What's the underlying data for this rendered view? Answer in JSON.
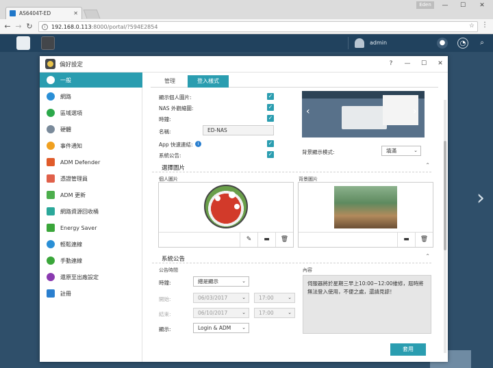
{
  "browser": {
    "tab_title": "AS6404T-ED",
    "user_chip": "Eden",
    "url_host": "192.168.0.113",
    "url_path": ":8000/portal/?594E2854"
  },
  "taskbar": {
    "user": "admin"
  },
  "dialog": {
    "title": "偏好設定",
    "controls": {
      "help": "?",
      "minimize": "—",
      "maximize": "☐",
      "close": "✕"
    }
  },
  "sidebar": {
    "items": [
      {
        "label": "一般",
        "icon": "general-icon",
        "color": "#ffffff"
      },
      {
        "label": "網路",
        "icon": "network-icon",
        "color": "#2a8fd6"
      },
      {
        "label": "區域選項",
        "icon": "region-icon",
        "color": "#2ba84a"
      },
      {
        "label": "硬體",
        "icon": "hardware-icon",
        "color": "#7a8a9a"
      },
      {
        "label": "事件通知",
        "icon": "notification-icon",
        "color": "#f0a020"
      },
      {
        "label": "ADM Defender",
        "icon": "defender-icon",
        "color": "#e05b2a"
      },
      {
        "label": "憑證管理員",
        "icon": "certificate-icon",
        "color": "#e0604a"
      },
      {
        "label": "ADM 更新",
        "icon": "update-icon",
        "color": "#4cae4c"
      },
      {
        "label": "網路資源回收桶",
        "icon": "recycle-bin-icon",
        "color": "#2ba89a"
      },
      {
        "label": "Energy Saver",
        "icon": "energy-saver-icon",
        "color": "#3aa63a"
      },
      {
        "label": "輕鬆連線",
        "icon": "cloud-connect-icon",
        "color": "#2a8fd6"
      },
      {
        "label": "手動連線",
        "icon": "manual-connect-icon",
        "color": "#3aa63a"
      },
      {
        "label": "還原至出廠設定",
        "icon": "restore-icon",
        "color": "#8a3ab0"
      },
      {
        "label": "註冊",
        "icon": "register-icon",
        "color": "#2a7fcf"
      }
    ]
  },
  "tabs": [
    "管理",
    "登入樣式"
  ],
  "login_style": {
    "show_personal_image": "顯示個人圖片:",
    "nas_thumbnail": "NAS 外觀縮圖:",
    "clock": "時鐘:",
    "name_label": "名稱:",
    "name_value": "ED-NAS",
    "app_shortcut": "App 快速連結:",
    "announcement": "系統公告:",
    "bg_mode_label": "背景顯示模式:",
    "bg_mode_value": "填滿"
  },
  "select_image": {
    "title": "選擇圖片",
    "personal_image": "個人圖片",
    "background_image": "背景圖片"
  },
  "system_announcement": {
    "title": "系統公告",
    "period_label": "公告時間",
    "content_label": "內容",
    "clock_label": "時鐘:",
    "clock_value": "總是顯示",
    "start_label": "開始:",
    "start_date": "06/03/2017",
    "start_time": "17:00",
    "end_label": "結束:",
    "end_date": "06/10/2017",
    "end_time": "17:00",
    "display_label": "顯示:",
    "display_value": "Login & ADM",
    "content_text": "伺服器將於星期三早上10:00~12:00維修，屆時將無法登入使用，不便之處，還請見諒！"
  },
  "apply_label": "套用"
}
